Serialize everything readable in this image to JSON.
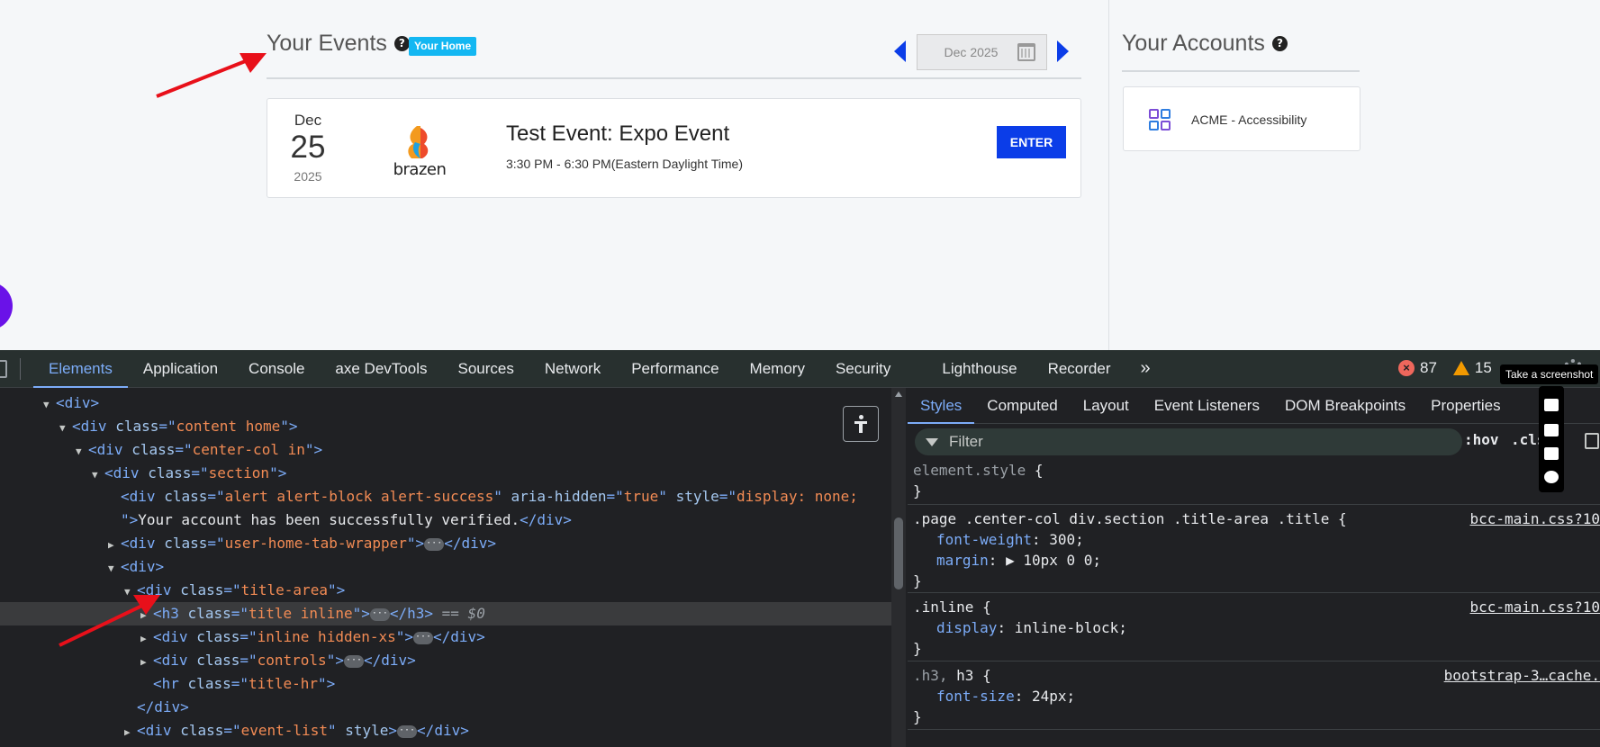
{
  "events": {
    "title": "Your Events",
    "help_glyph": "?",
    "home_badge": "Your Home",
    "month_picker_value": "Dec 2025",
    "items": [
      {
        "month": "Dec",
        "day": "25",
        "year": "2025",
        "logo_text": "brazen",
        "name": "Test Event: Expo Event",
        "time": "3:30 PM - 6:30 PM(Eastern Daylight Time)",
        "action_label": "ENTER"
      }
    ]
  },
  "accounts": {
    "title": "Your Accounts",
    "help_glyph": "?",
    "items": [
      {
        "name": "ACME - Accessibility"
      }
    ]
  },
  "devtools": {
    "tabs": [
      {
        "label": "Elements",
        "active": true
      },
      {
        "label": "Application"
      },
      {
        "label": "Console"
      },
      {
        "label": "axe DevTools"
      },
      {
        "label": "Sources"
      },
      {
        "label": "Network"
      },
      {
        "label": "Performance"
      },
      {
        "label": "Memory"
      },
      {
        "label": "Security"
      },
      {
        "label": "Lighthouse"
      },
      {
        "label": "Recorder"
      }
    ],
    "more_glyph": "»",
    "error_count": "87",
    "warning_count": "15",
    "tooltip": "Take a screenshot",
    "dom": {
      "div": "div",
      "content_home_tag": "div",
      "content_home_class": "content home",
      "center_col_tag": "div",
      "center_col_class": "center-col in",
      "section_tag": "div",
      "section_class": "section",
      "alert_tag": "div",
      "alert_class": "alert alert-block alert-success",
      "alert_aria_name": "aria-hidden",
      "alert_aria_value": "true",
      "alert_style_name": "style",
      "alert_style_value": "display: none;",
      "alert_text": "Your account has been successfully verified.",
      "tab_wrapper_tag": "div",
      "tab_wrapper_class": "user-home-tab-wrapper",
      "plain_div_tag": "div",
      "title_area_tag": "div",
      "title_area_class": "title-area",
      "h3_tag": "h3",
      "h3_class": "title inline",
      "selected_marker": "== $0",
      "hidden_xs_tag": "div",
      "hidden_xs_class": "inline hidden-xs",
      "controls_tag": "div",
      "controls_class": "controls",
      "hr_tag": "hr",
      "hr_class": "title-hr",
      "close_div": "div",
      "event_list_tag": "div",
      "event_list_class": "event-list",
      "event_list_style_attr": "style"
    },
    "styles_tabs": [
      {
        "label": "Styles",
        "active": true
      },
      {
        "label": "Computed"
      },
      {
        "label": "Layout"
      },
      {
        "label": "Event Listeners"
      },
      {
        "label": "DOM Breakpoints"
      },
      {
        "label": "Properties"
      }
    ],
    "filter_placeholder": "Filter",
    "hov_label": ":hov",
    "cls_label": ".cls",
    "rules": {
      "r1_selector": "element.style",
      "r2_selector": ".page .center-col div.section .title-area .title",
      "r2_source": "bcc-main.css?10",
      "r2_prop1": "font-weight",
      "r2_val1": "300",
      "r2_prop2": "margin",
      "r2_val2": "10px 0 0",
      "r3_selector": ".inline",
      "r3_source": "bcc-main.css?10",
      "r3_prop1": "display",
      "r3_val1": "inline-block",
      "r4_selector_dim": ".h3,",
      "r4_selector": "h3",
      "r4_source": "bootstrap-3…cache.",
      "r4_prop1": "font-size",
      "r4_val1": "24px"
    }
  },
  "colors": {
    "brand_blue": "#0b3de8",
    "badge_cyan": "#13b7f2",
    "arrow_red": "#e8101a",
    "devtools_accent": "#7cacf8"
  }
}
